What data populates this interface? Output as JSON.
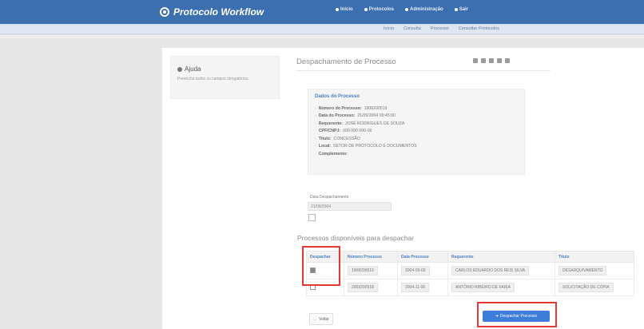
{
  "app": {
    "title": "Protocolo Workflow"
  },
  "topnav": [
    {
      "label": "Início"
    },
    {
      "label": "Protocolos"
    },
    {
      "label": "Administração"
    },
    {
      "label": "Sair"
    }
  ],
  "subnav": [
    {
      "label": "Início"
    },
    {
      "label": "Consulta"
    },
    {
      "label": "Processo"
    },
    {
      "label": "Consultar Protocolos"
    }
  ],
  "help": {
    "title": "Ajuda",
    "text": "Preencha todos os campos obrigatórios."
  },
  "main": {
    "title": "Despachamento de Processo",
    "panel_title": "Dados do Processo",
    "details": [
      {
        "label": "Número do Processo:",
        "value": "1908200519"
      },
      {
        "label": "Data do Processo:",
        "value": "21/09/2004 09:45:00"
      },
      {
        "label": "Requerente:",
        "value": "JOSÉ RODRIGUES DE SOUZA"
      },
      {
        "label": "CPF/CNPJ:",
        "value": "000.000.000-00"
      },
      {
        "label": "Título:",
        "value": "CONCESSÃO"
      },
      {
        "label": "Local:",
        "value": "SETOR DE PROTOCOLO E DOCUMENTOS"
      },
      {
        "label": "Complemento:",
        "value": ""
      }
    ],
    "field_label": "Data Despachamento",
    "field_value": "21/09/2004",
    "section_title": "Processos disponíveis para despachar",
    "table": {
      "headers": [
        "Despachar",
        "Número Processo",
        "Data Processo",
        "Requerente",
        "Título"
      ],
      "rows": [
        {
          "checked": true,
          "numero": "1908200519",
          "data": "2004-09-09",
          "requerente": "CARLOS EDUARDO DOS REIS SILVA",
          "titulo": "DESARQUIVAMENTO"
        },
        {
          "checked": false,
          "numero": "2009200518",
          "data": "2004-11-06",
          "requerente": "ANTÔNIO RIBEIRO DE FARIA",
          "titulo": "SOLICITAÇÃO DE CÓPIA"
        }
      ]
    },
    "back_label": "Voltar",
    "primary_label": "Despachar Processo"
  },
  "colors": {
    "topbar": "#3b6fb0",
    "accent": "#3b7dd8",
    "highlight": "#e53935"
  }
}
